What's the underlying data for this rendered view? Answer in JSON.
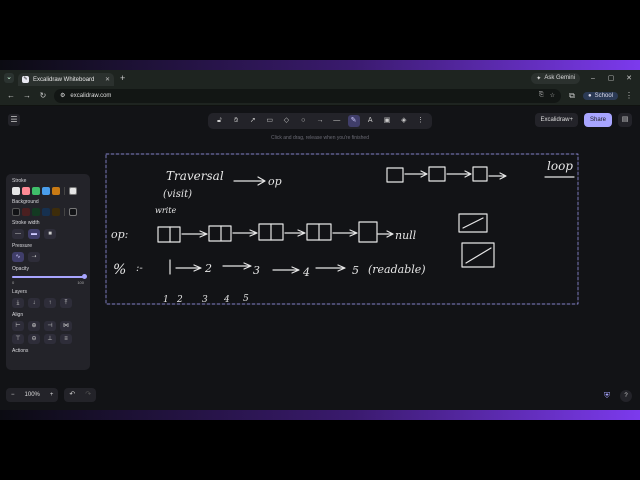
{
  "browser": {
    "tab_title": "Excalidraw Whiteboard",
    "tab_favicon": "excalidraw-logo",
    "new_tab_glyph": "+",
    "ask_gemini_label": "Ask Gemini",
    "url": "excalidraw.com",
    "profile_label": "School",
    "window_controls": [
      "–",
      "▢",
      "✕"
    ]
  },
  "app": {
    "hint_text": "Click and drag, release when you're finished",
    "excalidraw_plus_label": "Excalidraw+",
    "share_label": "Share",
    "toolbar_tools": [
      {
        "name": "lock-icon",
        "glyph": "🔓︎",
        "active": false
      },
      {
        "name": "hand-icon",
        "glyph": "✋︎",
        "active": false
      },
      {
        "name": "selection-icon",
        "glyph": "➚",
        "active": false
      },
      {
        "name": "rectangle-icon",
        "glyph": "▭",
        "active": false
      },
      {
        "name": "diamond-icon",
        "glyph": "◇",
        "active": false
      },
      {
        "name": "ellipse-icon",
        "glyph": "○",
        "active": false
      },
      {
        "name": "arrow-icon",
        "glyph": "→",
        "active": false
      },
      {
        "name": "line-icon",
        "glyph": "—",
        "active": false
      },
      {
        "name": "pencil-icon",
        "glyph": "✎",
        "active": true
      },
      {
        "name": "text-icon",
        "glyph": "A",
        "active": false
      },
      {
        "name": "image-icon",
        "glyph": "▣",
        "active": false
      },
      {
        "name": "eraser-icon",
        "glyph": "◈",
        "active": false
      },
      {
        "name": "more-tools-icon",
        "glyph": "⋮",
        "active": false
      }
    ],
    "panel": {
      "stroke_label": "Stroke",
      "stroke_colors": [
        "#e5e5e5",
        "#ff8a95",
        "#3fbf6a",
        "#4a9eeb",
        "#c87a14"
      ],
      "stroke_current": "#e5e5e5",
      "background_label": "Background",
      "background_colors": [
        "#121316",
        "#4a1f20",
        "#133a22",
        "#16304f",
        "#3d2c0a"
      ],
      "background_current": "#121316",
      "stroke_width_label": "Stroke width",
      "stroke_width_options": [
        "thin",
        "bold",
        "extra-bold"
      ],
      "stroke_width_active": 1,
      "pressure_label": "Pressure",
      "pressure_options": [
        "pressure-on",
        "pressure-fixed"
      ],
      "pressure_active": 0,
      "opacity_label": "Opacity",
      "opacity_value": 100,
      "opacity_min_label": "0",
      "opacity_max_label": "100",
      "layers_label": "Layers",
      "layer_buttons": [
        "send-to-back",
        "send-backward",
        "bring-forward",
        "bring-to-front"
      ],
      "align_label": "Align",
      "align_buttons": [
        "align-left",
        "align-center-h",
        "align-right",
        "distribute-h",
        "align-top",
        "align-center-v",
        "align-bottom",
        "distribute-v"
      ],
      "actions_label": "Actions"
    },
    "zoom_level": "100%",
    "zoom_out_glyph": "−",
    "zoom_in_glyph": "+",
    "undo_glyph": "↶",
    "redo_glyph": "↷",
    "help_glyph": "?"
  },
  "canvas_text": {
    "traversal": "Traversal",
    "op": "op",
    "visit": "(visit)",
    "write": "write",
    "op_label": "op:",
    "null": "null",
    "loop": "loop",
    "nums_row": [
      "1",
      "2",
      "3",
      "4",
      "5"
    ],
    "nums_bottom": [
      "1",
      "2",
      "3",
      "4",
      "5"
    ],
    "readable": "(readable)",
    "percent": "%",
    "arrow_text": ":-"
  }
}
